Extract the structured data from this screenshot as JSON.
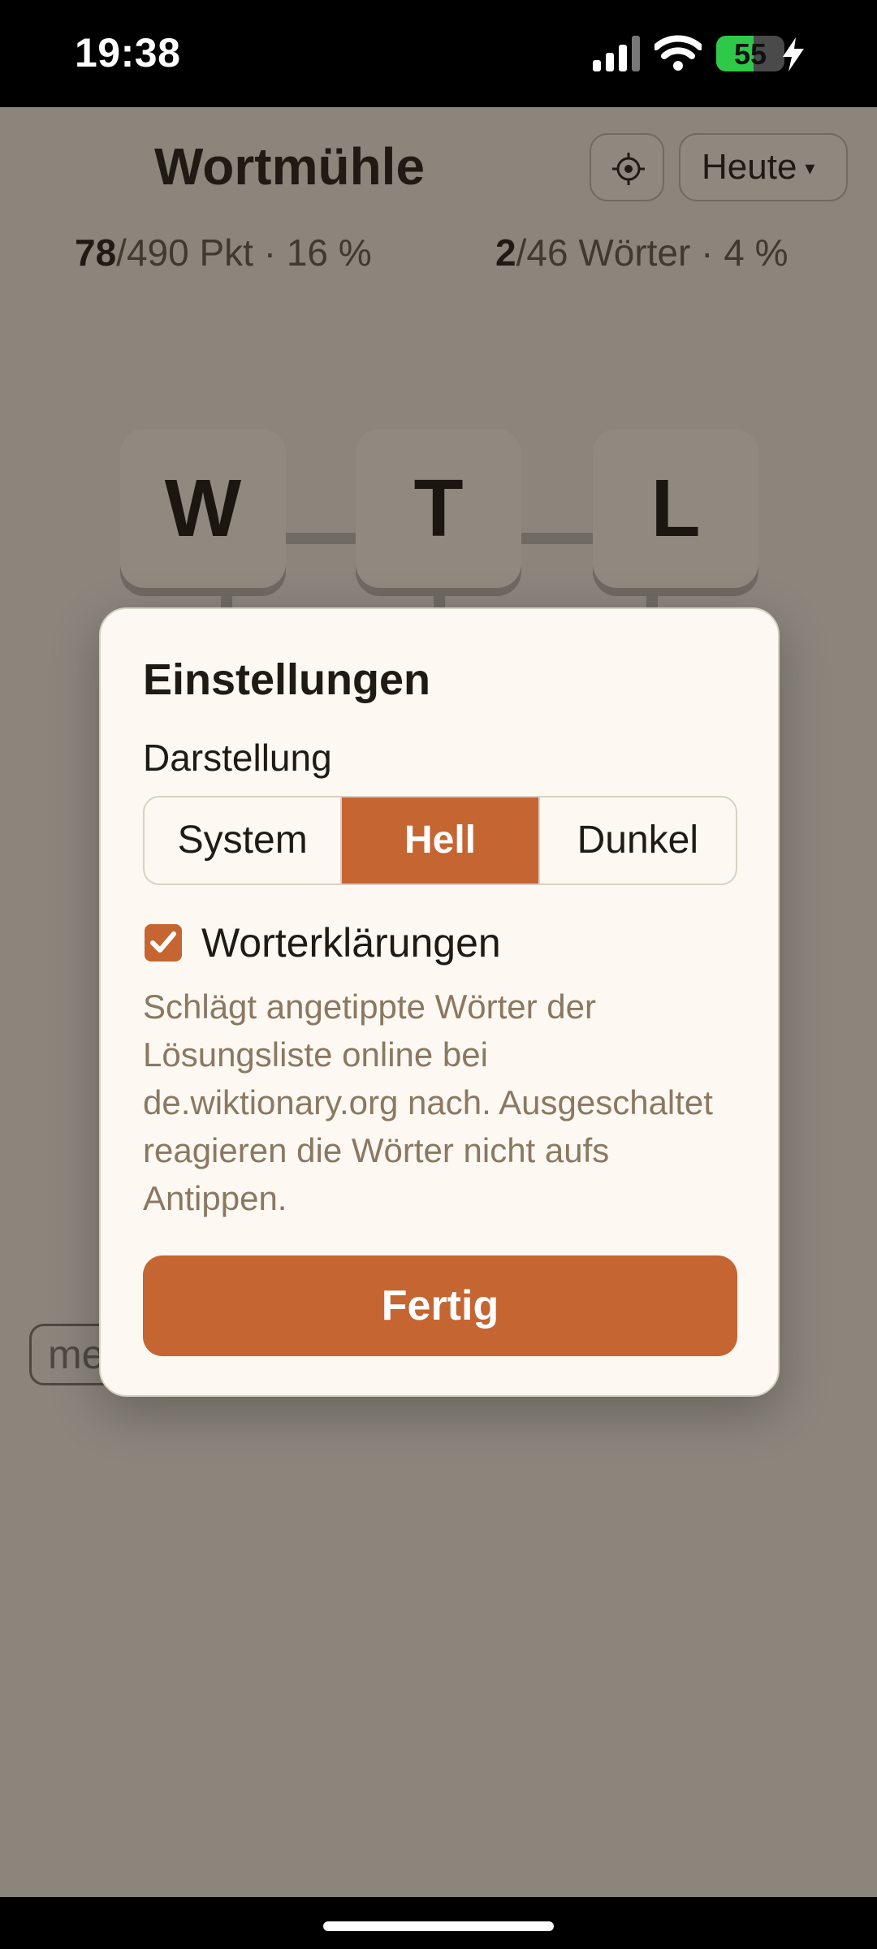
{
  "status_bar": {
    "time": "19:38",
    "battery_level": "55",
    "battery_fraction": 0.55,
    "signal_icon": "signal-bars-icon",
    "wifi_icon": "wifi-icon",
    "charging_icon": "charging-bolt-icon"
  },
  "header": {
    "title": "Wortmühle",
    "settings_icon": "gear-icon",
    "date_button_label": "Heute",
    "date_button_caret": "▾"
  },
  "stats": {
    "points_found": "78",
    "points_rest": "/490 Pkt · 16 %",
    "words_found": "2",
    "words_rest": "/46 Wörter · 4 %"
  },
  "board": {
    "tiles": [
      "W",
      "T",
      "L"
    ]
  },
  "word_chip": {
    "text": "me"
  },
  "settings_dialog": {
    "title": "Einstellungen",
    "appearance_label": "Darstellung",
    "appearance_options": [
      "System",
      "Hell",
      "Dunkel"
    ],
    "appearance_selected": "Hell",
    "definitions_checkbox_label": "Worterklärungen",
    "definitions_checked": true,
    "definitions_description": "Schlägt angetippte Wörter der Lösungsliste online bei de.wiktionary.org nach. Ausgeschaltet reagieren die Wörter nicht aufs Antippen.",
    "done_label": "Fertig"
  },
  "colors": {
    "accent": "#c46532",
    "dialog_background": "#fdf8f1",
    "dimmed_background": "#8b857c",
    "description_text": "#8a7862",
    "battery_green": "#2fc949"
  }
}
